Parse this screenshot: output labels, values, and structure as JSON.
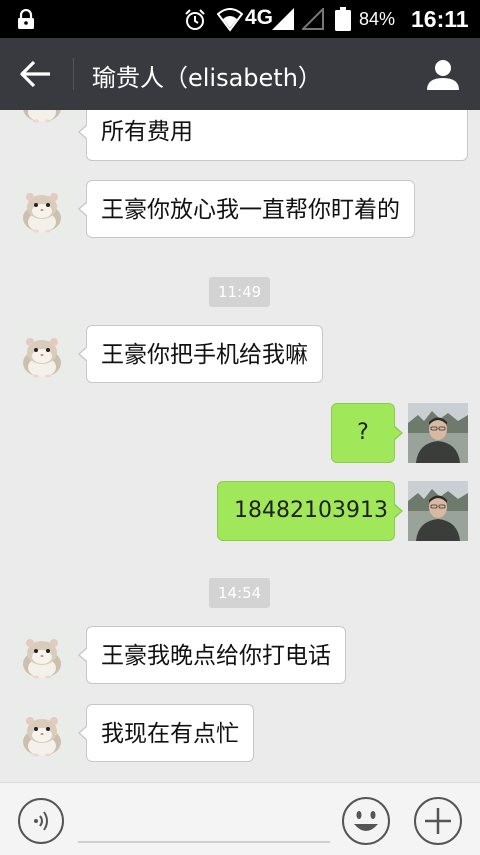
{
  "status_bar": {
    "network": "4G",
    "battery": "84%",
    "time": "16:11"
  },
  "header": {
    "title": "瑜贵人（elisabeth）"
  },
  "messages": [
    {
      "side": "left",
      "text": "所有费用"
    },
    {
      "side": "left",
      "text": "王豪你放心我一直帮你盯着的"
    },
    {
      "type": "time",
      "text": "11:49"
    },
    {
      "side": "left",
      "text": "王豪你把手机给我嘛"
    },
    {
      "side": "right",
      "text": "?"
    },
    {
      "side": "right",
      "text": "18482103913"
    },
    {
      "type": "time",
      "text": "14:54"
    },
    {
      "side": "left",
      "text": "王豪我晚点给你打电话"
    },
    {
      "side": "left",
      "text": "我现在有点忙"
    }
  ],
  "icons": {
    "status": [
      "lock-icon",
      "alarm-icon",
      "wifi-icon",
      "signal-icon",
      "battery-icon"
    ],
    "header": [
      "back-arrow-icon",
      "user-profile-icon"
    ],
    "input_bar": [
      "voice-icon",
      "emoji-icon",
      "plus-icon"
    ]
  },
  "colors": {
    "title_bar": "#393a3f",
    "sent_bubble": "#a0e75a",
    "received_bubble": "#ffffff",
    "chat_background": "#ebebeb"
  }
}
